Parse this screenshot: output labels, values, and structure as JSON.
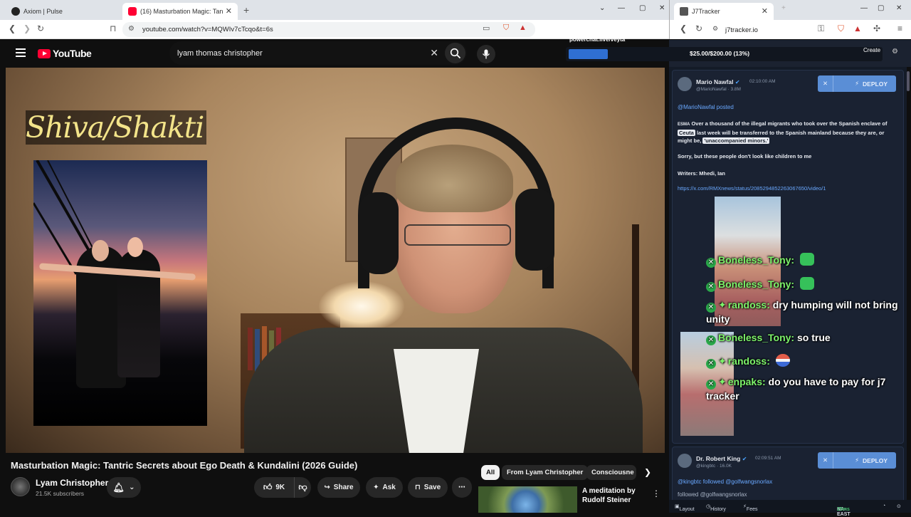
{
  "browser_left": {
    "tabs": [
      {
        "label": "Axiom | Pulse",
        "active": false
      },
      {
        "label": "(16) Masturbation Magic: Tan",
        "active": true
      }
    ],
    "url": "youtube.com/watch?v=MQWIv7cTcqo&t=6s"
  },
  "browser_right": {
    "tab_label": "J7Tracker",
    "url": "j7tracker.io"
  },
  "youtube": {
    "logo_text": "YouTube",
    "search_value": "lyam thomas christopher",
    "video": {
      "overlay_title": "Shiva/Shakti",
      "title": "Masturbation Magic: Tantric Secrets about Ego Death & Kundalini (2026 Guide)"
    },
    "channel": {
      "name": "Lyam Christopher",
      "subscribers": "21.5K subscribers"
    },
    "actions": {
      "likes": "9K",
      "share": "Share",
      "ask": "Ask",
      "save": "Save"
    },
    "chips": [
      "All",
      "From Lyam Christopher",
      "Consciousne"
    ],
    "recommendation": {
      "title_line1": "A meditation by",
      "title_line2": "Rudolf Steiner"
    }
  },
  "tracker": {
    "stream_label": "powerchat.live/veyta",
    "progress": {
      "label": "$25.00/$200.00 (13%)",
      "fraction": 0.125
    },
    "create_label": "Create",
    "cards": [
      {
        "name": "Mario Nawfal",
        "handle": "@MarioNawfal",
        "followers": "3.8M",
        "time": "02:10:00 AM",
        "deploy": "DEPLOY",
        "posted": "@MarioNawfal posted",
        "prefix": "ESMA",
        "text_a": "Over a thousand of the illegal migrants who took over the Spanish enclave of",
        "text_b_hl": "Ceuta",
        "text_c": "last week will be transferred to the Spanish mainland because they are, or might be,",
        "text_d_hl": "'unaccompanied minors.'",
        "line2": "Sorry, but these people don't look like children to me",
        "writers": "Writers: Mhedi, Ian",
        "link": "https://x.com/RMXnews/status/2085294852263067650/video/1"
      },
      {
        "name": "Dr. Robert King",
        "handle": "@kingbtc",
        "followers": "16.0K",
        "time": "02:09:51 AM",
        "deploy": "DEPLOY",
        "posted": "@kingbtc followed @golfwangsnorlax",
        "followed_partial": "followed @golfwangsnorlax"
      }
    ],
    "chat": [
      {
        "user": "Boneless_Tony:",
        "msg": ""
      },
      {
        "user": "Boneless_Tony:",
        "msg": ""
      },
      {
        "user": "randoss:",
        "msg": "dry humping will not bring"
      },
      {
        "user": "",
        "msg": "unity"
      },
      {
        "user": "Boneless_Tony:",
        "msg": "so true"
      },
      {
        "user": "randoss:",
        "msg": ""
      },
      {
        "user": "enpaks:",
        "msg": "do you have to pay for j7"
      },
      {
        "user": "",
        "msg": "tracker"
      }
    ],
    "bottom": {
      "layout": "Layout",
      "history": "History",
      "fees": "Fees",
      "region": "NA-EAST",
      "ping": "25ms"
    }
  }
}
